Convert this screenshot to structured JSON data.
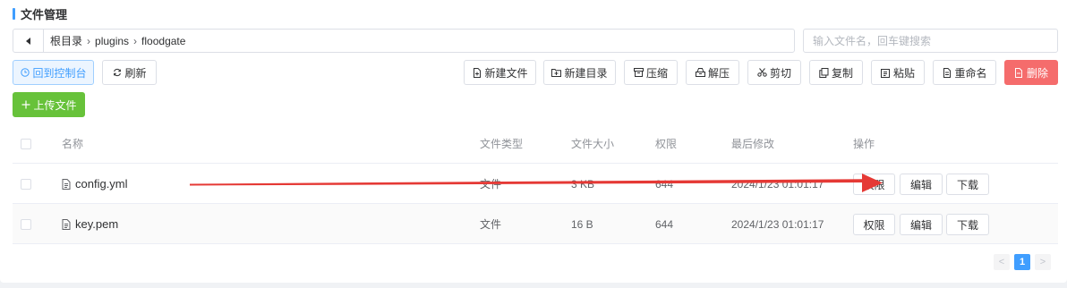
{
  "header": {
    "title": "文件管理"
  },
  "path": {
    "items": [
      "根目录",
      "plugins",
      "floodgate"
    ]
  },
  "search": {
    "placeholder": "输入文件名，回车键搜索"
  },
  "toolbar": {
    "console_label": "回到控制台",
    "refresh_label": "刷新",
    "new_file_label": "新建文件",
    "new_dir_label": "新建目录",
    "compress_label": "压缩",
    "extract_label": "解压",
    "cut_label": "剪切",
    "copy_label": "复制",
    "paste_label": "粘贴",
    "rename_label": "重命名",
    "delete_label": "删除",
    "upload_label": "上传文件"
  },
  "table": {
    "headers": {
      "name": "名称",
      "type": "文件类型",
      "size": "文件大小",
      "perm": "权限",
      "modified": "最后修改",
      "actions": "操作"
    },
    "rows": [
      {
        "name": "config.yml",
        "type": "文件",
        "size": "3 KB",
        "perm": "644",
        "modified": "2024/1/23 01:01:17"
      },
      {
        "name": "key.pem",
        "type": "文件",
        "size": "16 B",
        "perm": "644",
        "modified": "2024/1/23 01:01:17"
      }
    ],
    "actions": {
      "perm": "权限",
      "edit": "编辑",
      "download": "下载"
    }
  },
  "pagination": {
    "current": "1",
    "prev": "<",
    "next": ">"
  },
  "colors": {
    "primary": "#409eff",
    "danger": "#f56c6c",
    "success": "#67c23a",
    "annotation_arrow": "#e53935"
  },
  "icons": [
    "back-arrow-icon",
    "clock-icon",
    "refresh-icon",
    "file-plus-icon",
    "folder-plus-icon",
    "archive-icon",
    "unarchive-icon",
    "scissors-icon",
    "copy-icon",
    "clipboard-icon",
    "rename-icon",
    "trash-icon",
    "plus-icon",
    "file-icon"
  ]
}
